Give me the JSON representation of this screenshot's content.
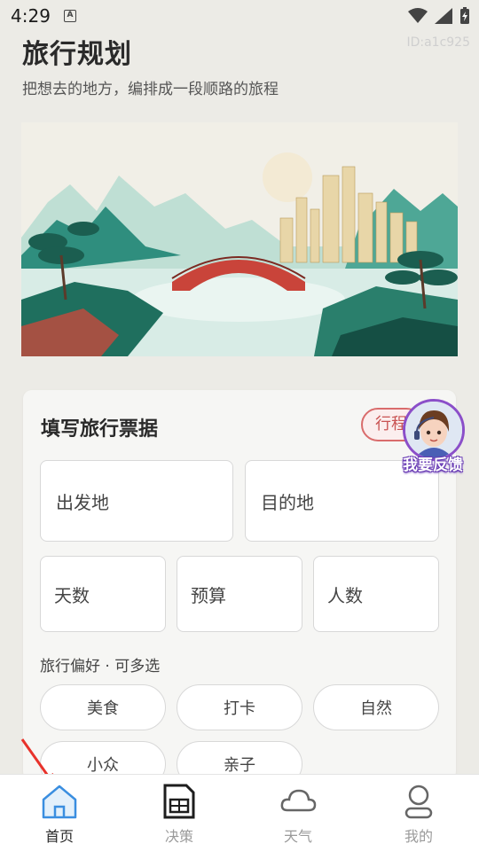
{
  "status": {
    "time": "4:29",
    "notification_letter": "A"
  },
  "header": {
    "title": "旅行规划",
    "id": "ID:a1c925",
    "subtitle": "把想去的地方，编排成一段顺路的旅程"
  },
  "form": {
    "title": "填写旅行票据",
    "tag": "行程",
    "fields": {
      "departure": "出发地",
      "destination": "目的地",
      "days": "天数",
      "budget": "预算",
      "people": "人数"
    },
    "preferences_label": "旅行偏好 · 可多选",
    "preferences": [
      "美食",
      "打卡",
      "自然",
      "小众",
      "亲子"
    ]
  },
  "feedback": {
    "label": "我要反馈"
  },
  "nav": {
    "home": "首页",
    "decision": "决策",
    "weather": "天气",
    "mine": "我的",
    "active": "home"
  },
  "colors": {
    "accent_blue": "#3a8ee0",
    "tag_red": "#d96c6c",
    "feedback_purple": "#8b4fc9"
  }
}
